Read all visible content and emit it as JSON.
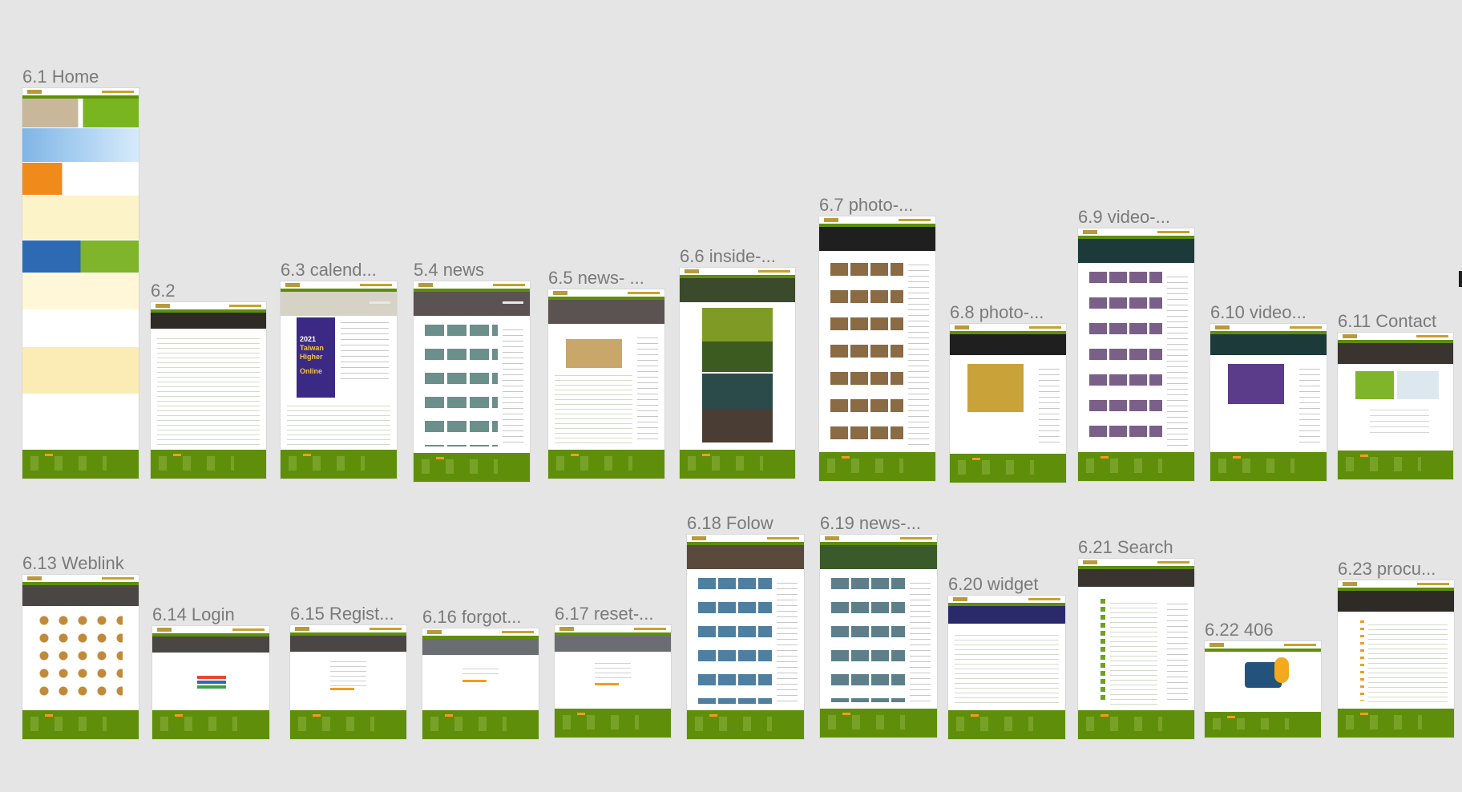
{
  "frames": [
    {
      "id": "home",
      "label": "6.1 Home"
    },
    {
      "id": "f62",
      "label": "6.2"
    },
    {
      "id": "calendar",
      "label": "6.3 calend..."
    },
    {
      "id": "news",
      "label": "5.4 news"
    },
    {
      "id": "news-detail",
      "label": "6.5 news- ..."
    },
    {
      "id": "inside",
      "label": "6.6 inside-..."
    },
    {
      "id": "photo",
      "label": "6.7 photo-..."
    },
    {
      "id": "photo-detail",
      "label": "6.8 photo-..."
    },
    {
      "id": "video",
      "label": "6.9 video-..."
    },
    {
      "id": "video-detail",
      "label": "6.10 video..."
    },
    {
      "id": "contact",
      "label": "6.11 Contact"
    },
    {
      "id": "weblink",
      "label": "6.13 Weblink"
    },
    {
      "id": "login",
      "label": "6.14 Login"
    },
    {
      "id": "register",
      "label": "6.15 Regist..."
    },
    {
      "id": "forgot",
      "label": "6.16 forgot..."
    },
    {
      "id": "reset",
      "label": "6.17 reset-..."
    },
    {
      "id": "follow",
      "label": "6.18 Folow"
    },
    {
      "id": "news2",
      "label": "6.19 news-..."
    },
    {
      "id": "widget",
      "label": "6.20 widget"
    },
    {
      "id": "search",
      "label": "6.21 Search"
    },
    {
      "id": "e406",
      "label": "6.22 406"
    },
    {
      "id": "procurement",
      "label": "6.23 procu..."
    }
  ],
  "thumb_text": {
    "calendar_poster": [
      "2021",
      "Taiwan",
      "Higher",
      "Online"
    ]
  },
  "colors": {
    "canvas": "#e5e5e5",
    "brand_green": "#5f8f0a",
    "accent_orange": "#f29c1f",
    "label_gray": "#7a7a7a"
  }
}
